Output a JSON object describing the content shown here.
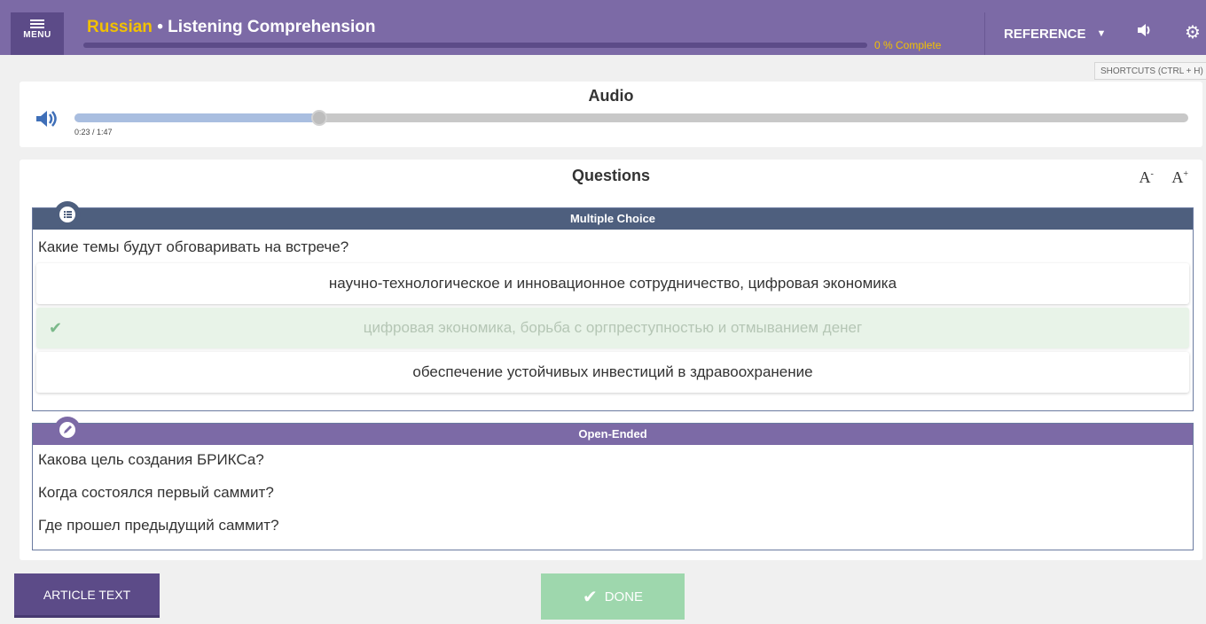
{
  "topbar": {
    "menu_label": "MENU",
    "language": "Russian",
    "separator": "•",
    "lesson_title": "Listening Comprehension",
    "progress_text": "0 % Complete",
    "progress_value_percent": 0,
    "reference_label": "REFERENCE",
    "shortcuts_tooltip": "SHORTCUTS (CTRL + H)"
  },
  "audio": {
    "heading": "Audio",
    "time_display": "0:23 / 1:47",
    "played_fraction": 0.22
  },
  "questions": {
    "heading": "Questions",
    "font_decrease": "A",
    "font_increase": "A",
    "multiple_choice": {
      "header": "Multiple Choice",
      "question": "Какие темы будут обговаривать на встрече?",
      "choices": [
        {
          "text": "научно-технологическое и инновационное сотрудничество, цифровая экономика",
          "selected": false
        },
        {
          "text": "цифровая экономика, борьба с оргпреступностью и отмыванием денег",
          "selected": true
        },
        {
          "text": "обеспечение устойчивых инвестиций в здравоохранение",
          "selected": false
        }
      ]
    },
    "open_ended": {
      "header": "Open-Ended",
      "items": [
        "Какова цель создания БРИКСа?",
        "Когда состоялся первый саммит?",
        "Где прошел предыдущий саммит?"
      ]
    }
  },
  "buttons": {
    "article_text": "ARTICLE TEXT",
    "done": "DONE"
  },
  "colors": {
    "topbar": "#7c6aa6",
    "accent_yellow": "#f2c100",
    "mc_header": "#4e5f7e",
    "done_button": "#9ed7ad"
  }
}
